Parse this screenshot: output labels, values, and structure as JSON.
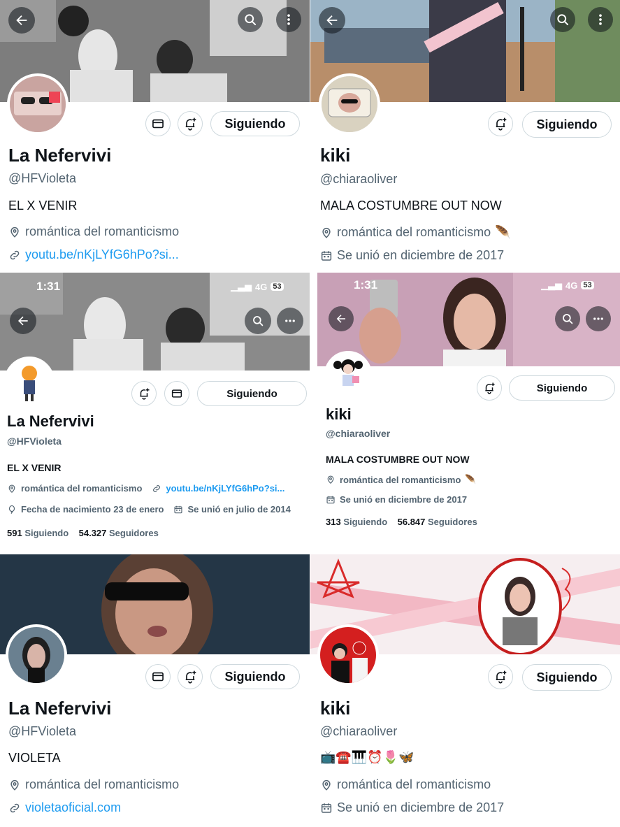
{
  "colors": {
    "accent": "#1d9bf0",
    "text": "#0f1419",
    "muted": "#536471",
    "border": "#cfd9de"
  },
  "panels": [
    {
      "name": "La Nefervivi",
      "handle": "@HFVioleta",
      "bio": "EL X VENIR",
      "location": "romántica del romanticismo",
      "link": "youtu.be/nKjLYfG6hPo?si...",
      "follow_label": "Siguiendo",
      "icons": [
        "back-arrow-icon",
        "search-icon",
        "more-vertical-icon",
        "mail-icon",
        "bell-plus-icon",
        "location-pin-icon",
        "link-icon"
      ]
    },
    {
      "name": "kiki",
      "handle": "@chiaraoliver",
      "bio": "MALA COSTUMBRE OUT NOW",
      "location": "romántica del romanticismo",
      "location_emoji": "🪶",
      "joined": "Se unió en diciembre de 2017",
      "follow_label": "Siguiendo",
      "icons": [
        "back-arrow-icon",
        "search-icon",
        "more-vertical-icon",
        "bell-plus-icon",
        "location-pin-icon",
        "calendar-icon"
      ]
    },
    {
      "status_time": "1:31",
      "status_network": "4G",
      "status_battery": "53",
      "name": "La Nefervivi",
      "handle": "@HFVioleta",
      "bio": "EL X VENIR",
      "location": "romántica del romanticismo",
      "link": "youtu.be/nKjLYfG6hPo?si...",
      "birthday": "Fecha de nacimiento 23 de enero",
      "joined": "Se unió en julio de 2014",
      "following_count": "591",
      "following_label": "Siguiendo",
      "followers_count": "54.327",
      "followers_label": "Seguidores",
      "follow_label": "Siguiendo",
      "icons": [
        "back-arrow-icon",
        "search-icon",
        "more-horizontal-icon",
        "bell-plus-icon",
        "mail-icon",
        "location-pin-icon",
        "link-icon",
        "balloon-icon",
        "calendar-icon"
      ]
    },
    {
      "status_time": "1:31",
      "status_network": "4G",
      "status_battery": "53",
      "name": "kiki",
      "handle": "@chiaraoliver",
      "bio": "MALA COSTUMBRE OUT NOW",
      "location": "romántica del romanticismo",
      "location_emoji": "🪶",
      "joined": "Se unió en diciembre de 2017",
      "following_count": "313",
      "following_label": "Siguiendo",
      "followers_count": "56.847",
      "followers_label": "Seguidores",
      "follow_label": "Siguiendo",
      "icons": [
        "back-arrow-icon",
        "search-icon",
        "more-horizontal-icon",
        "bell-plus-icon",
        "location-pin-icon",
        "calendar-icon"
      ]
    },
    {
      "name": "La Nefervivi",
      "handle": "@HFVioleta",
      "bio": "VIOLETA",
      "location": "romántica del romanticismo",
      "link": "violetaoficial.com",
      "follow_label": "Siguiendo",
      "icons": [
        "mail-icon",
        "bell-plus-icon",
        "location-pin-icon",
        "link-icon"
      ]
    },
    {
      "name": "kiki",
      "handle": "@chiaraoliver",
      "bio": "📺☎️🎹⏰🌷🦋",
      "location": "romántica del romanticismo",
      "joined": "Se unió en diciembre de 2017",
      "follow_label": "Siguiendo",
      "icons": [
        "bell-plus-icon",
        "location-pin-icon",
        "calendar-icon"
      ]
    }
  ]
}
